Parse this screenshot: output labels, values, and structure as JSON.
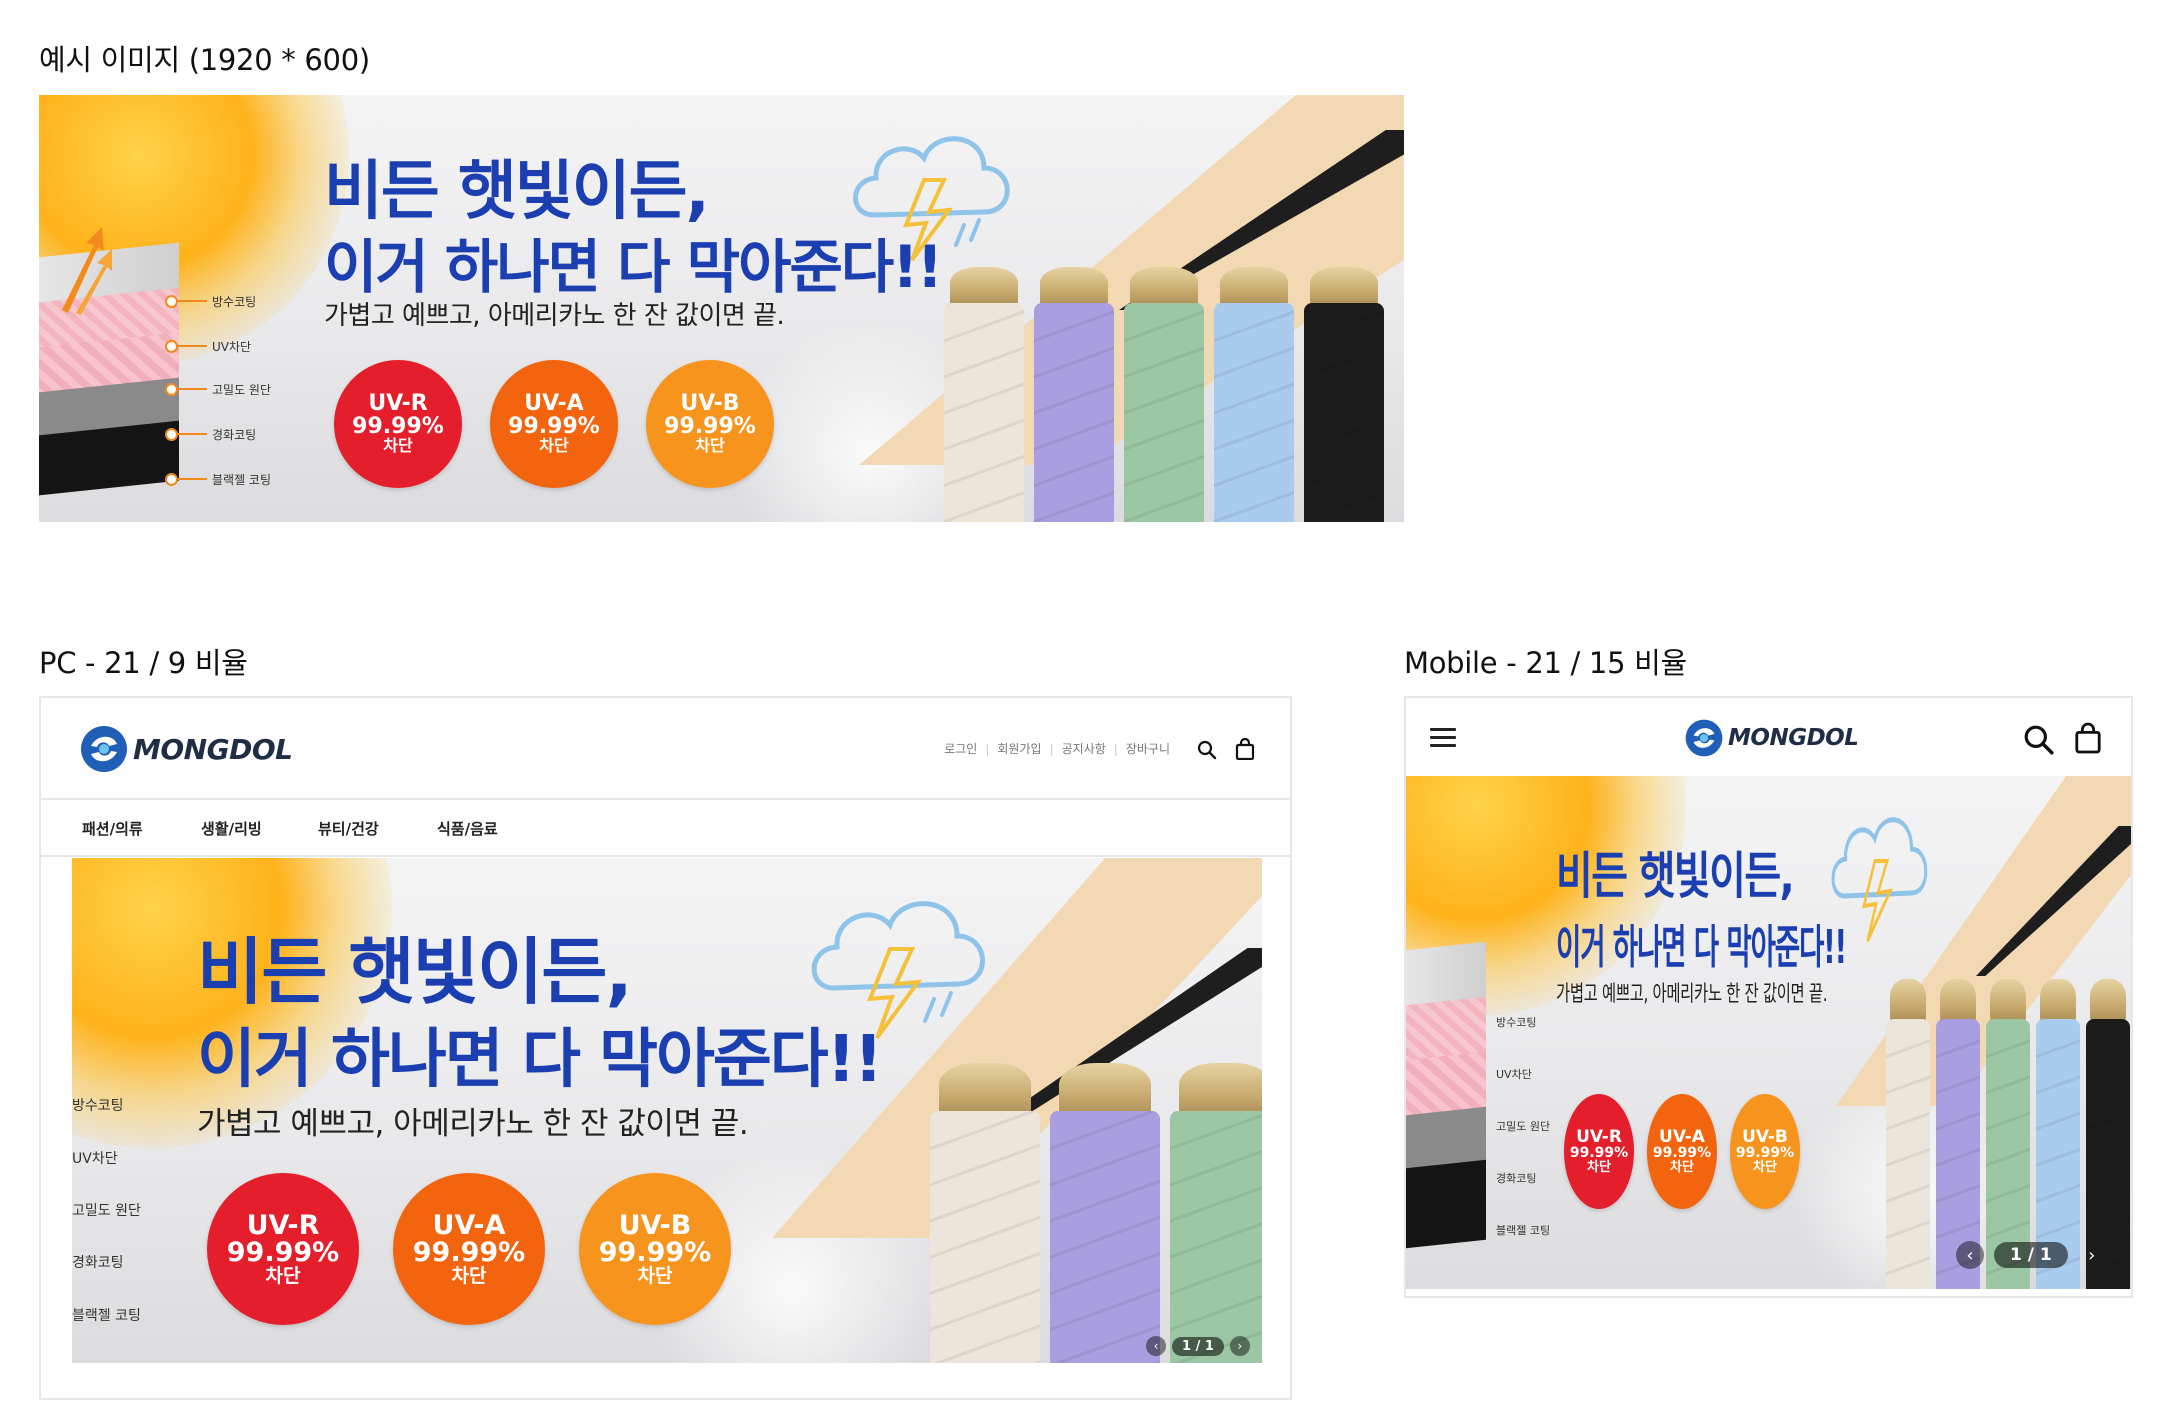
{
  "labels": {
    "sample": "예시 이미지 (1920 * 600)",
    "pc": "PC - 21 / 9 비율",
    "mobile": "Mobile - 21 / 15 비율"
  },
  "banner": {
    "headline_1": "비든 햇빛이든,",
    "headline_2": "이거 하나면 다 막아준다!!",
    "subtext": "가볍고 예쁘고, 아메리카노 한 잔 값이면 끝.",
    "badges": [
      {
        "line1": "UV-R",
        "line2": "99.99%",
        "line3": "차단",
        "color": "#e41e2b"
      },
      {
        "line1": "UV-A",
        "line2": "99.99%",
        "line3": "차단",
        "color": "#f2640d"
      },
      {
        "line1": "UV-B",
        "line2": "99.99%",
        "line3": "차단",
        "color": "#f7941d"
      }
    ],
    "layers": [
      "방수코팅",
      "UV차단",
      "고밀도 원단",
      "경화코팅",
      "블랙젤 코팅"
    ],
    "pc_layers_cropped": [
      "방수코팅",
      "UV차단",
      "고밀도 원단",
      "경화코팅",
      "블랙젤 코팅"
    ],
    "umbrella_colors": [
      "#ece6da",
      "#a99ee0",
      "#9cc7a4",
      "#a9cbee",
      "#1c1c1c"
    ],
    "accent_blue": "#1b3fb0"
  },
  "pc": {
    "logo_text": "MONGDOL",
    "util_links": [
      "로그인",
      "회원가입",
      "공지사항",
      "장바구니"
    ],
    "menu": [
      "패션/의류",
      "생활/리빙",
      "뷰티/건강",
      "식품/음료"
    ],
    "pager": "1 / 1"
  },
  "mobile": {
    "logo_text": "MONGDOL",
    "pager": "1 / 1"
  },
  "icons": {
    "search": "search-icon",
    "cart": "shopping-bag-icon",
    "menu": "hamburger-menu-icon",
    "prev": "chevron-left-icon",
    "next": "chevron-right-icon"
  }
}
